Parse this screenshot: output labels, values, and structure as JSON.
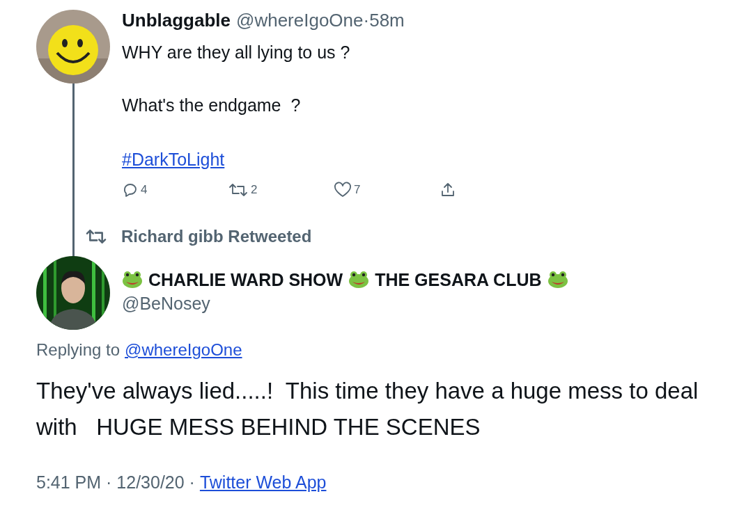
{
  "reply_tweet": {
    "display_name": "Unblaggable",
    "handle": "@whereIgoOne",
    "separator": "·",
    "time": "58m",
    "lines": [
      "WHY are they all lying to us ?",
      "What's the endgame  ?"
    ],
    "hashtag": "#DarkToLight",
    "actions": [
      {
        "kind": "reply",
        "count": "4"
      },
      {
        "kind": "retweet",
        "count": "2"
      },
      {
        "kind": "like",
        "count": "7"
      },
      {
        "kind": "share"
      }
    ]
  },
  "retweet_notice": "Richard gibb Retweeted",
  "main_tweet": {
    "name_parts": [
      {
        "kind": "frog"
      },
      {
        "kind": "text",
        "text": "CHARLIE WARD SHOW"
      },
      {
        "kind": "frog"
      },
      {
        "kind": "text",
        "text": "THE GESARA CLUB"
      },
      {
        "kind": "frog"
      }
    ],
    "handle": "@BeNosey",
    "replying_prefix": "Replying to",
    "replying_handle": "@whereIgoOne",
    "body": "They've always lied.....!  This time they have a huge mess to deal with   HUGE MESS BEHIND THE SCENES",
    "timestamp": "5:41 PM · 12/30/20 ·",
    "source": "Twitter Web App"
  }
}
